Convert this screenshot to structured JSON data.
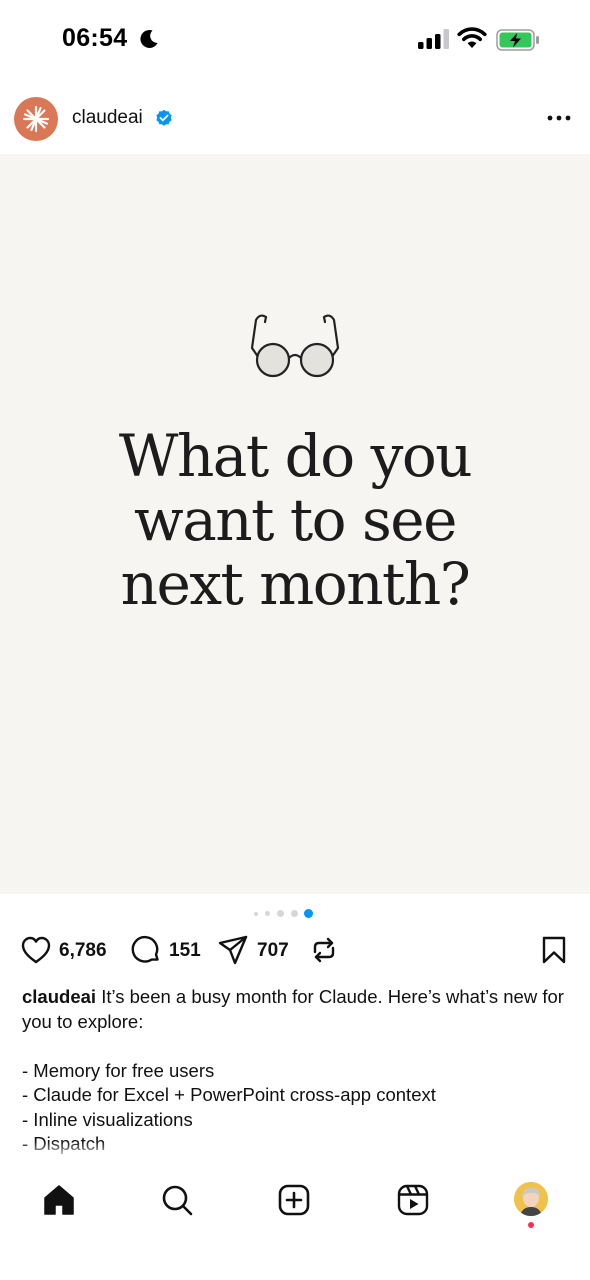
{
  "status_bar": {
    "time": "06:54",
    "icons": [
      "moon-icon",
      "signal-icon",
      "wifi-icon",
      "battery-charging-icon"
    ],
    "battery_color": "#34c759"
  },
  "post": {
    "username": "claudeai",
    "verified": true,
    "avatar_color": "#d97757",
    "verified_color": "#0095f6",
    "media": {
      "background": "#f6f5f1",
      "icon": "reading-glasses-icon",
      "headline": "What do you\nwant to see\nnext month?"
    },
    "carousel": {
      "total_dots": 5,
      "active_index": 4,
      "active_color": "#0095f6"
    },
    "actions": {
      "likes": "6,786",
      "comments": "151",
      "shares": "707"
    },
    "caption": {
      "user": "claudeai",
      "lines": "It’s been a busy month for Claude. Here’s what’s new for you to explore:\n\n- Memory for free users\n- Claude for Excel + PowerPoint cross-app context\n- Inline visualizations\n- Dispatch\n- Projects in Cowork"
    }
  },
  "bottom_nav": {
    "items": [
      "home-icon",
      "search-icon",
      "create-icon",
      "reels-icon",
      "profile-avatar"
    ],
    "notification_dot_color": "#ff2d55"
  }
}
